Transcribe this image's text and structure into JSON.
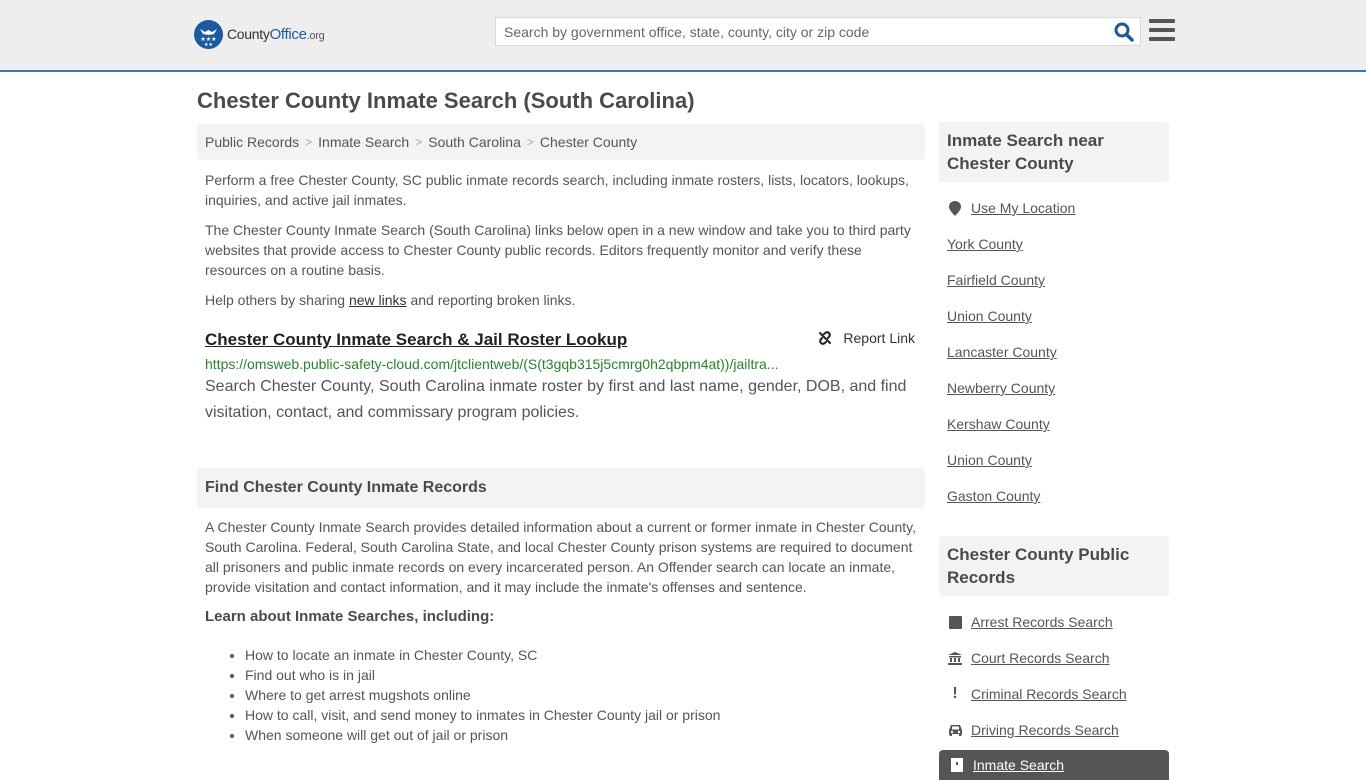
{
  "header": {
    "logo": {
      "name_part1": "County",
      "name_part2": "Office",
      "tld": ".org"
    },
    "search": {
      "placeholder": "Search by government office, state, county, city or zip code",
      "value": ""
    },
    "icons": {
      "search": "search-icon",
      "menu": "hamburger-menu-icon"
    }
  },
  "page": {
    "title": "Chester County Inmate Search (South Carolina)"
  },
  "breadcrumb": [
    {
      "label": "Public Records"
    },
    {
      "label": "Inmate Search"
    },
    {
      "label": "South Carolina"
    },
    {
      "label": "Chester County"
    }
  ],
  "intro": {
    "p1": "Perform a free Chester County, SC public inmate records search, including inmate rosters, lists, locators, lookups, inquiries, and active jail inmates.",
    "p2": "The Chester County Inmate Search (South Carolina) links below open in a new window and take you to third party websites that provide access to Chester County public records. Editors frequently monitor and verify these resources on a routine basis.",
    "p3_before": "Help others by sharing ",
    "p3_link": "new links",
    "p3_after": " and reporting broken links."
  },
  "results": [
    {
      "title": "Chester County Inmate Search & Jail Roster Lookup",
      "report_label": "Report Link",
      "url": "https://omsweb.public-safety-cloud.com/jtclientweb/(S(t3gqb315j5cmrg0h2qbpm4at))/jailtra...",
      "description": "Search Chester County, South Carolina inmate roster by first and last name, gender, DOB, and find visitation, contact, and commissary program policies."
    }
  ],
  "find_section": {
    "heading": "Find Chester County Inmate Records",
    "body": "A Chester County Inmate Search provides detailed information about a current or former inmate in Chester County, South Carolina. Federal, South Carolina State, and local Chester County prison systems are required to document all prisoners and public inmate records on every incarcerated person. An Offender search can locate an inmate, provide visitation and contact information, and it may include the inmate's offenses and sentence.",
    "learn_heading": "Learn about Inmate Searches, including:",
    "learn_items": [
      "How to locate an inmate in Chester County, SC",
      "Find out who is in jail",
      "Where to get arrest mugshots online",
      "How to call, visit, and send money to inmates in Chester County jail or prison",
      "When someone will get out of jail or prison"
    ]
  },
  "sidebar_nearby": {
    "heading": "Inmate Search near Chester County",
    "use_location": "Use My Location",
    "counties": [
      "York County",
      "Fairfield County",
      "Union County",
      "Lancaster County",
      "Newberry County",
      "Kershaw County",
      "Union County",
      "Gaston County"
    ]
  },
  "sidebar_records": {
    "heading": "Chester County Public Records",
    "items": [
      {
        "label": "Arrest Records Search",
        "icon": "square-icon"
      },
      {
        "label": "Court Records Search",
        "icon": "courthouse-icon"
      },
      {
        "label": "Criminal Records Search",
        "icon": "exclamation-icon"
      },
      {
        "label": "Driving Records Search",
        "icon": "car-icon"
      }
    ],
    "active_item": {
      "label": "Inmate Search",
      "icon": "jail-door-icon"
    }
  },
  "colors": {
    "accent": "#3379b7",
    "brand": "#1c5aa0",
    "url_green": "#26842b",
    "active_bg": "#555555"
  }
}
